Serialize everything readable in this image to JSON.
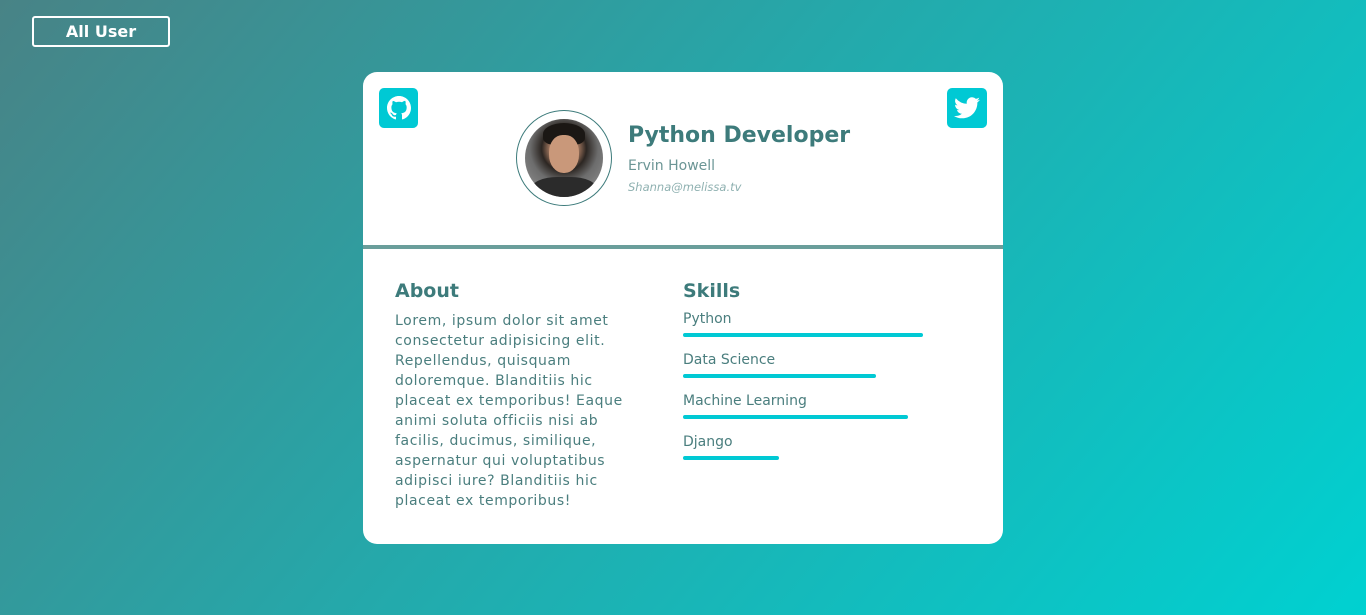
{
  "nav": {
    "all_user_label": "All User"
  },
  "profile": {
    "title": "Python Developer",
    "name": "Ervin Howell",
    "email": "Shanna@melissa.tv"
  },
  "social": {
    "github_icon": "github-icon",
    "twitter_icon": "twitter-icon"
  },
  "about": {
    "heading": "About",
    "text": "Lorem, ipsum dolor sit amet consectetur adipisicing elit. Repellendus, quisquam doloremque. Blanditiis hic placeat ex temporibus! Eaque animi soluta officiis nisi ab facilis, ducimus, similique, aspernatur qui voluptatibus adipisci iure? Blanditiis hic placeat ex temporibus!"
  },
  "skills": {
    "heading": "Skills",
    "items": [
      {
        "label": "Python",
        "level": 0.96
      },
      {
        "label": "Data Science",
        "level": 0.77
      },
      {
        "label": "Machine Learning",
        "level": 0.9
      },
      {
        "label": "Django",
        "level": 0.385
      }
    ]
  },
  "colors": {
    "accent": "#00c9d4",
    "heading": "#3d7b7b",
    "text": "#4a7e7e",
    "divider": "#6a9e9b"
  }
}
